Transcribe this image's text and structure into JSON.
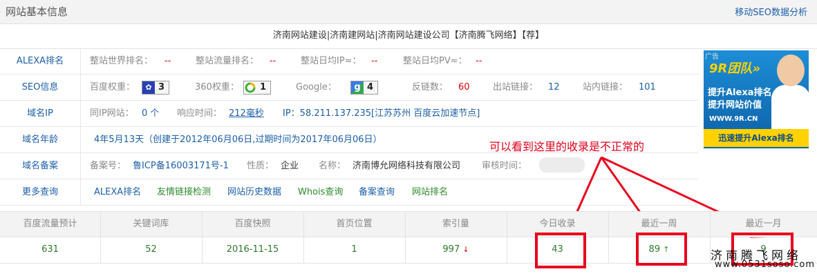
{
  "header": {
    "title": "网站基本信息",
    "mobile_link": "移动SEO数据分析"
  },
  "site_title": "济南网站建设|济南建网站|济南网站建设公司【济南腾飞网络】【荐】",
  "rows": {
    "alexa": {
      "label": "ALEXA排名",
      "world_rank_label": "整站世界排名：",
      "world_rank": "--",
      "traffic_rank_label": "整站流量排名：",
      "traffic_rank": "--",
      "daily_ip_label": "整站日均IP≈：",
      "daily_ip": "--",
      "daily_pv_label": "整站日均PV≈：",
      "daily_pv": "--"
    },
    "seo": {
      "label": "SEO信息",
      "baidu_weight_label": "百度权重：",
      "baidu_weight": "3",
      "w360_label": "360权重：",
      "w360": "1",
      "google_label": "Google：",
      "google": "4",
      "backlinks_label": "反链数：",
      "backlinks": "60",
      "outlinks_label": "出站链接：",
      "outlinks": "12",
      "inlinks_label": "站内链接：",
      "inlinks": "101"
    },
    "ip": {
      "label": "域名IP",
      "same_ip_label": "同IP网站：",
      "same_ip": "0 个",
      "resp_label": "响应时间：",
      "resp": "212毫秒",
      "ip_text": "IP：58.211.137.235[江苏苏州 百度云加速节点]"
    },
    "age": {
      "label": "域名年龄",
      "text": "4年5月13天（创建于2012年06月06日,过期时间为2017年06月06日）"
    },
    "icp": {
      "label": "域名备案",
      "no_label": "备案号：",
      "no": "鲁ICP备16003171号-1",
      "nature_label": "性质：",
      "nature": "企业",
      "name_label": "名称：",
      "name": "济南博允网络科技有限公司",
      "time_label": "审核时间："
    },
    "more": {
      "label": "更多查询",
      "links": [
        "ALEXA排名",
        "友情链接检测",
        "网站历史数据",
        "Whois查询",
        "备案查询",
        "网站排名"
      ]
    }
  },
  "ad": {
    "tag": "广告",
    "brand": "9R团队»",
    "line1": "提升Alexa排名",
    "line2": "提升网站价值",
    "url": "WWW.9R.CN",
    "cta": "迅速提升Alexa排名"
  },
  "annotation": "可以看到这里的收录是不正常的",
  "table": {
    "headers": [
      "百度流量预计",
      "关键词库",
      "百度快照",
      "首页位置",
      "索引量",
      "今日收录",
      "最近一周",
      "最近一月"
    ],
    "values": [
      "631",
      "52",
      "2016-11-15",
      "1",
      "997",
      "43",
      "89",
      "9"
    ],
    "arrows": {
      "index": "↓",
      "week": "↑"
    }
  },
  "watermark": {
    "line1": "济南腾飞网络",
    "line2": "www.0531soso.com"
  },
  "colors": {
    "link_blue": "#1b5fa8",
    "value_green": "#2b8a2b",
    "value_red": "#dd0000",
    "annotation_red": "#e8001c"
  }
}
